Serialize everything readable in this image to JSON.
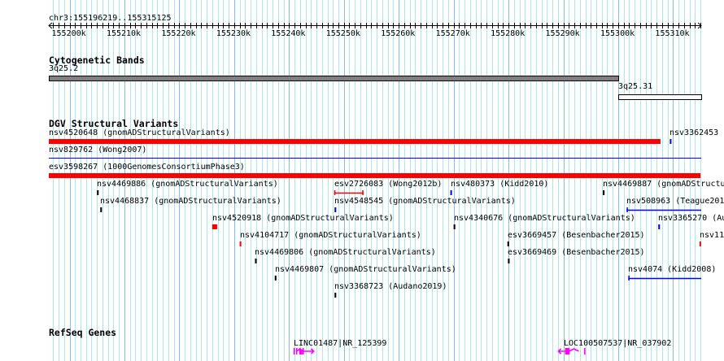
{
  "view": {
    "location": "chr3:155196219..155315125",
    "start_kb": 155196.219,
    "end_kb": 155315.125,
    "ticks": [
      "155200k",
      "155210k",
      "155220k",
      "155230k",
      "155240k",
      "155250k",
      "155260k",
      "155270k",
      "155280k",
      "155290k",
      "155300k",
      "155310k"
    ]
  },
  "colors": {
    "grid_minor": "#a8e8ee",
    "grid_major": "#80c0e8",
    "red": "#ff0000",
    "blue": "#0000ff",
    "black": "#000000",
    "gray": "#808080",
    "magenta": "#ff00ff"
  },
  "tracks": {
    "cyto": {
      "title": "Cytogenetic Bands",
      "bands": [
        {
          "label": "3q25.2",
          "start": 155196.219,
          "end": 155300.0,
          "fill": "#808080"
        },
        {
          "label": "3q25.31",
          "start": 155300.0,
          "end": 155315.125,
          "fill": "#ffffff"
        }
      ]
    },
    "dgv": {
      "title": "DGV Structural Variants",
      "features": [
        {
          "label": "nsv4520648 (gnomADStructuralVariants)",
          "start": 155196.219,
          "end": 155307.7,
          "color": "red",
          "style": "thick"
        },
        {
          "label": "nsv3362453 (",
          "start": 155309.4,
          "end": 155309.7,
          "color": "blue",
          "style": "thick"
        },
        {
          "label": "nsv829762 (Wong2007)",
          "start": 155196.219,
          "end": 155315.125,
          "color": "blue",
          "style": "line"
        },
        {
          "label": "esv3598267 (1000GenomesConsortiumPhase3)",
          "start": 155196.219,
          "end": 155315.0,
          "color": "red",
          "style": "thick"
        },
        {
          "label": "nsv4469886 (gnomADStructuralVariants)",
          "start": 155205.0,
          "end": 155205.3,
          "color": "black",
          "style": "thick"
        },
        {
          "label": "esv2726083 (Wong2012b)",
          "start": 155248.2,
          "end": 155253.6,
          "color": "red",
          "style": "ibeam"
        },
        {
          "label": "nsv480373 (Kidd2010)",
          "start": 155269.4,
          "end": 155269.7,
          "color": "blue",
          "style": "thick"
        },
        {
          "label": "nsv4469887 (gnomADStructu",
          "start": 155297.2,
          "end": 155297.5,
          "color": "black",
          "style": "thick"
        },
        {
          "label": "nsv4468837 (gnomADStructuralVariants)",
          "start": 155205.6,
          "end": 155205.9,
          "color": "black",
          "style": "thick"
        },
        {
          "label": "nsv4548545 (gnomADStructuralVariants)",
          "start": 155248.3,
          "end": 155248.6,
          "color": "blue",
          "style": "thick"
        },
        {
          "label": "nsv508963 (Teague2010",
          "start": 155301.5,
          "end": 155315.125,
          "color": "blue",
          "style": "tline"
        },
        {
          "label": "nsv4520918 (gnomADStructuralVariants)",
          "start": 155226.0,
          "end": 155226.9,
          "color": "red",
          "style": "thick"
        },
        {
          "label": "nsv4340676 (gnomADStructuralVariants)",
          "start": 155270.0,
          "end": 155270.3,
          "color": "black",
          "style": "thick"
        },
        {
          "label": "nsv3365270 (Au",
          "start": 155307.3,
          "end": 155307.6,
          "color": "blue",
          "style": "thick"
        },
        {
          "label": "nsv4104717 (gnomADStructuralVariants)",
          "start": 155231.0,
          "end": 155231.3,
          "color": "red",
          "style": "thick"
        },
        {
          "label": "esv3669457 (Besenbacher2015)",
          "start": 155279.8,
          "end": 155280.1,
          "color": "black",
          "style": "thick"
        },
        {
          "label": "nsv113",
          "start": 155314.8,
          "end": 155315.1,
          "color": "red",
          "style": "thick"
        },
        {
          "label": "nsv4469806 (gnomADStructuralVariants)",
          "start": 155233.8,
          "end": 155234.1,
          "color": "black",
          "style": "thick"
        },
        {
          "label": "esv3669469 (Besenbacher2015)",
          "start": 155279.9,
          "end": 155280.2,
          "color": "black",
          "style": "thick"
        },
        {
          "label": "nsv4469807 (gnomADStructuralVariants)",
          "start": 155237.4,
          "end": 155237.7,
          "color": "black",
          "style": "thick"
        },
        {
          "label": "nsv4074 (Kidd2008)",
          "start": 155301.8,
          "end": 155315.125,
          "color": "blue",
          "style": "tline"
        },
        {
          "label": "nsv3368723 (Audano2019)",
          "start": 155248.3,
          "end": 155248.6,
          "color": "black",
          "style": "thick"
        }
      ]
    },
    "genes": {
      "title": "RefSeq Genes",
      "features": [
        {
          "label": "LINC01487|NR_125399",
          "start": 155240.8,
          "end": 155244.5,
          "strand": "+"
        },
        {
          "label": "LOC100507537|NR_037902",
          "start": 155289.1,
          "end": 155293.9,
          "strand": "-"
        }
      ]
    }
  }
}
